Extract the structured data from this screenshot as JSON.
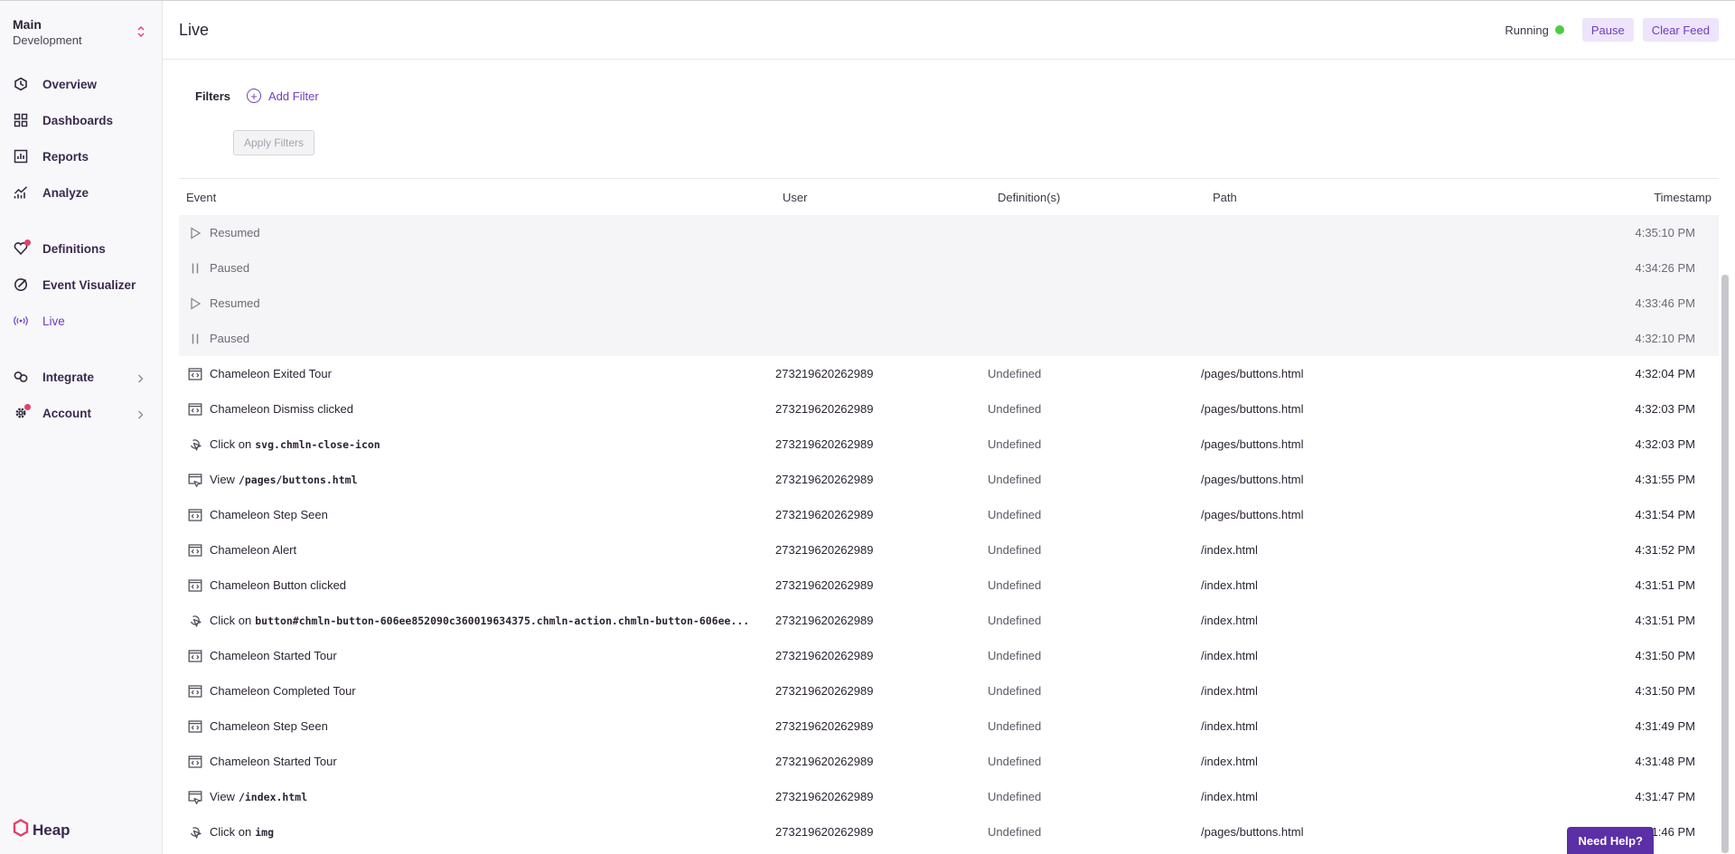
{
  "environment": {
    "project": "Main",
    "env": "Development"
  },
  "nav": {
    "items": [
      {
        "label": "Overview",
        "icon": "hexagon-icon"
      },
      {
        "label": "Dashboards",
        "icon": "grid-icon"
      },
      {
        "label": "Reports",
        "icon": "report-icon"
      },
      {
        "label": "Analyze",
        "icon": "analyze-icon"
      },
      {
        "label": "Definitions",
        "icon": "definitions-icon"
      },
      {
        "label": "Event Visualizer",
        "icon": "visualizer-icon"
      },
      {
        "label": "Live",
        "icon": "broadcast-icon",
        "active": true
      },
      {
        "label": "Integrate",
        "icon": "link-icon"
      },
      {
        "label": "Account",
        "icon": "gear-icon"
      }
    ]
  },
  "logo": {
    "text": "Heap"
  },
  "header": {
    "title": "Live",
    "status": "Running",
    "pause_label": "Pause",
    "clear_label": "Clear Feed"
  },
  "filters": {
    "label": "Filters",
    "add_label": "Add Filter",
    "apply_label": "Apply Filters"
  },
  "table": {
    "columns": [
      "Event",
      "User",
      "Definition(s)",
      "Path",
      "Timestamp"
    ],
    "rows": [
      {
        "type": "system",
        "icon": "play-icon",
        "event": "Resumed",
        "user": "",
        "def": "",
        "path": "",
        "time": "4:35:10 PM"
      },
      {
        "type": "system",
        "icon": "pause-icon",
        "event": "Paused",
        "user": "",
        "def": "",
        "path": "",
        "time": "4:34:26 PM"
      },
      {
        "type": "system",
        "icon": "play-icon",
        "event": "Resumed",
        "user": "",
        "def": "",
        "path": "",
        "time": "4:33:46 PM"
      },
      {
        "type": "system",
        "icon": "pause-icon",
        "event": "Paused",
        "user": "",
        "def": "",
        "path": "",
        "time": "4:32:10 PM"
      },
      {
        "type": "custom",
        "icon": "code-icon",
        "event": "Chameleon Exited Tour",
        "code": "",
        "user": "273219620262989",
        "def": "Undefined",
        "path": "/pages/buttons.html",
        "time": "4:32:04 PM"
      },
      {
        "type": "custom",
        "icon": "code-icon",
        "event": "Chameleon Dismiss clicked",
        "code": "",
        "user": "273219620262989",
        "def": "Undefined",
        "path": "/pages/buttons.html",
        "time": "4:32:03 PM"
      },
      {
        "type": "click",
        "icon": "click-icon",
        "event": "Click on",
        "code": "svg.chmln-close-icon",
        "user": "273219620262989",
        "def": "Undefined",
        "path": "/pages/buttons.html",
        "time": "4:32:03 PM"
      },
      {
        "type": "view",
        "icon": "view-icon",
        "event": "View",
        "code": "/pages/buttons.html",
        "user": "273219620262989",
        "def": "Undefined",
        "path": "/pages/buttons.html",
        "time": "4:31:55 PM"
      },
      {
        "type": "custom",
        "icon": "code-icon",
        "event": "Chameleon Step Seen",
        "code": "",
        "user": "273219620262989",
        "def": "Undefined",
        "path": "/pages/buttons.html",
        "time": "4:31:54 PM"
      },
      {
        "type": "custom",
        "icon": "code-icon",
        "event": "Chameleon Alert",
        "code": "",
        "user": "273219620262989",
        "def": "Undefined",
        "path": "/index.html",
        "time": "4:31:52 PM"
      },
      {
        "type": "custom",
        "icon": "code-icon",
        "event": "Chameleon Button clicked",
        "code": "",
        "user": "273219620262989",
        "def": "Undefined",
        "path": "/index.html",
        "time": "4:31:51 PM"
      },
      {
        "type": "click",
        "icon": "click-icon",
        "event": "Click on",
        "code": "button#chmln-button-606ee852090c360019634375.chmln-action.chmln-button-606ee...",
        "user": "273219620262989",
        "def": "Undefined",
        "path": "/index.html",
        "time": "4:31:51 PM"
      },
      {
        "type": "custom",
        "icon": "code-icon",
        "event": "Chameleon Started Tour",
        "code": "",
        "user": "273219620262989",
        "def": "Undefined",
        "path": "/index.html",
        "time": "4:31:50 PM"
      },
      {
        "type": "custom",
        "icon": "code-icon",
        "event": "Chameleon Completed Tour",
        "code": "",
        "user": "273219620262989",
        "def": "Undefined",
        "path": "/index.html",
        "time": "4:31:50 PM"
      },
      {
        "type": "custom",
        "icon": "code-icon",
        "event": "Chameleon Step Seen",
        "code": "",
        "user": "273219620262989",
        "def": "Undefined",
        "path": "/index.html",
        "time": "4:31:49 PM"
      },
      {
        "type": "custom",
        "icon": "code-icon",
        "event": "Chameleon Started Tour",
        "code": "",
        "user": "273219620262989",
        "def": "Undefined",
        "path": "/index.html",
        "time": "4:31:48 PM"
      },
      {
        "type": "view",
        "icon": "view-icon",
        "event": "View",
        "code": "/index.html",
        "user": "273219620262989",
        "def": "Undefined",
        "path": "/index.html",
        "time": "4:31:47 PM"
      },
      {
        "type": "click",
        "icon": "click-icon",
        "event": "Click on",
        "code": "img",
        "user": "273219620262989",
        "def": "Undefined",
        "path": "/pages/buttons.html",
        "time": "4:31:46 PM"
      }
    ]
  },
  "help": {
    "label": "Need Help?"
  },
  "colors": {
    "accent": "#6d3fc0",
    "running": "#4ccd43",
    "help": "#5b2fa6"
  }
}
